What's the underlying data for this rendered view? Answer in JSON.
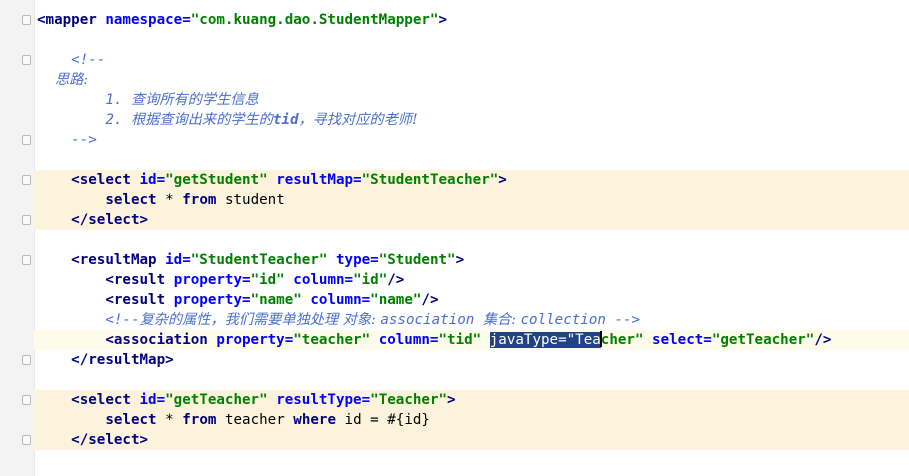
{
  "editor": {
    "lines": [
      {
        "t": "",
        "segs": [
          [
            "tag",
            "<mapper "
          ],
          [
            "attr",
            "namespace="
          ],
          [
            "val",
            "\"com.kuang.dao.StudentMapper\""
          ],
          [
            "tag",
            ">"
          ]
        ]
      },
      {
        "t": "",
        "segs": []
      },
      {
        "t": "",
        "segs": [
          [
            "cmi",
            "    <!--"
          ]
        ]
      },
      {
        "t": "",
        "segs": [
          [
            "cmj",
            "    思路:"
          ]
        ]
      },
      {
        "t": "",
        "segs": [
          [
            "cmi",
            "        1. "
          ],
          [
            "cmj",
            "查询所有的学生信息"
          ]
        ]
      },
      {
        "t": "",
        "segs": [
          [
            "cmi",
            "        2. "
          ],
          [
            "cmj",
            "根据查询出来的学生的"
          ],
          [
            "cmb",
            "tid"
          ],
          [
            "cmj",
            "，寻找对应的老师!"
          ]
        ]
      },
      {
        "t": "",
        "segs": [
          [
            "cmi",
            "    -->"
          ]
        ]
      },
      {
        "t": "",
        "segs": []
      },
      {
        "t": "sql",
        "segs": [
          [
            "plain",
            "    "
          ],
          [
            "tag",
            "<select "
          ],
          [
            "attr",
            "id="
          ],
          [
            "val",
            "\"getStudent\" "
          ],
          [
            "attr",
            "resultMap="
          ],
          [
            "val",
            "\"StudentTeacher\""
          ],
          [
            "tag",
            ">"
          ]
        ]
      },
      {
        "t": "sql",
        "segs": [
          [
            "plain",
            "        "
          ],
          [
            "kw",
            "select "
          ],
          [
            "plain",
            "* "
          ],
          [
            "kw",
            "from "
          ],
          [
            "plain",
            "student"
          ]
        ]
      },
      {
        "t": "sql",
        "segs": [
          [
            "plain",
            "    "
          ],
          [
            "tag",
            "</select>"
          ]
        ]
      },
      {
        "t": "",
        "segs": []
      },
      {
        "t": "",
        "segs": [
          [
            "plain",
            "    "
          ],
          [
            "tag",
            "<resultMap "
          ],
          [
            "attr",
            "id="
          ],
          [
            "val",
            "\"StudentTeacher\" "
          ],
          [
            "attr",
            "type="
          ],
          [
            "val",
            "\"Student\""
          ],
          [
            "tag",
            ">"
          ]
        ]
      },
      {
        "t": "",
        "segs": [
          [
            "plain",
            "        "
          ],
          [
            "tag",
            "<result "
          ],
          [
            "attr",
            "property="
          ],
          [
            "val",
            "\"id\" "
          ],
          [
            "attr",
            "column="
          ],
          [
            "val",
            "\"id\""
          ],
          [
            "tag",
            "/>"
          ]
        ]
      },
      {
        "t": "",
        "segs": [
          [
            "plain",
            "        "
          ],
          [
            "tag",
            "<result "
          ],
          [
            "attr",
            "property="
          ],
          [
            "val",
            "\"name\" "
          ],
          [
            "attr",
            "column="
          ],
          [
            "val",
            "\"name\""
          ],
          [
            "tag",
            "/>"
          ]
        ]
      },
      {
        "t": "",
        "segs": [
          [
            "plain",
            "        "
          ],
          [
            "cmi",
            "<!--"
          ],
          [
            "cmj",
            "复杂的属性，我们需要单独处理 对象: "
          ],
          [
            "cmi",
            "association "
          ],
          [
            "cmj",
            "集合: "
          ],
          [
            "cmi",
            "collection -->"
          ]
        ]
      },
      {
        "t": "cur",
        "segs": [
          [
            "plain",
            "        "
          ],
          [
            "tag",
            "<association "
          ],
          [
            "attr",
            "property="
          ],
          [
            "val",
            "\"teacher\" "
          ],
          [
            "attr",
            "column="
          ],
          [
            "val",
            "\"tid\" "
          ],
          [
            "sel",
            "javaType=\"Tea"
          ],
          [
            "caret",
            ""
          ],
          [
            "val",
            "cher\" "
          ],
          [
            "attr",
            "select="
          ],
          [
            "val",
            "\"getTeacher\""
          ],
          [
            "tag",
            "/>"
          ]
        ]
      },
      {
        "t": "",
        "segs": [
          [
            "plain",
            "    "
          ],
          [
            "tag",
            "</resultMap>"
          ]
        ]
      },
      {
        "t": "",
        "segs": []
      },
      {
        "t": "sql",
        "segs": [
          [
            "plain",
            "    "
          ],
          [
            "tag",
            "<select "
          ],
          [
            "attr",
            "id="
          ],
          [
            "val",
            "\"getTeacher\" "
          ],
          [
            "attr",
            "resultType="
          ],
          [
            "val",
            "\"Teacher\""
          ],
          [
            "tag",
            ">"
          ]
        ]
      },
      {
        "t": "sql",
        "segs": [
          [
            "plain",
            "        "
          ],
          [
            "kw",
            "select "
          ],
          [
            "plain",
            "* "
          ],
          [
            "kw",
            "from "
          ],
          [
            "plain",
            "teacher "
          ],
          [
            "kw",
            "where "
          ],
          [
            "plain",
            "id = #{id}"
          ]
        ]
      },
      {
        "t": "sql",
        "segs": [
          [
            "plain",
            "    "
          ],
          [
            "tag",
            "</select>"
          ]
        ]
      },
      {
        "t": "",
        "segs": []
      }
    ]
  },
  "colors": {
    "tag": "#000080",
    "attr": "#0000ff",
    "value": "#008000",
    "comment": "#4b6fd1",
    "sql_highlight": "#fcf3dc",
    "selection": "#214283"
  }
}
